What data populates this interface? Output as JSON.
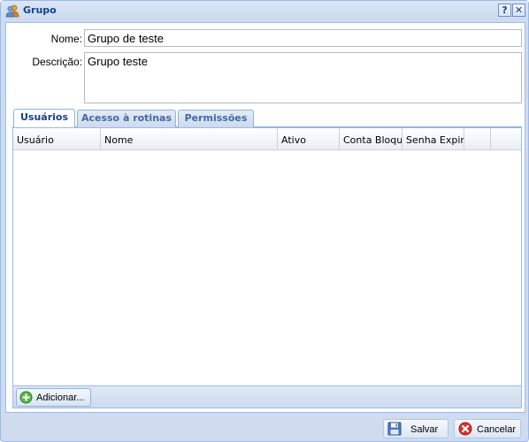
{
  "window": {
    "title": "Grupo",
    "help_label": "?",
    "close_label": "✕"
  },
  "form": {
    "nome_label": "Nome:",
    "nome_value": "Grupo de teste",
    "descricao_label": "Descrição:",
    "descricao_value": "Grupo teste"
  },
  "tabs": [
    {
      "label": "Usuários",
      "active": true
    },
    {
      "label": "Acesso à rotinas",
      "active": false
    },
    {
      "label": "Permissões",
      "active": false
    }
  ],
  "grid": {
    "columns": [
      "Usuário",
      "Nome",
      "Ativo",
      "Conta Bloque",
      "Senha Expiro",
      ""
    ],
    "rows": []
  },
  "grid_toolbar": {
    "add_label": "Adicionar..."
  },
  "footer": {
    "save_label": "Salvar",
    "cancel_label": "Cancelar"
  },
  "icons": {
    "window": "group-icon",
    "add": "add-circle-icon",
    "save": "floppy-disk-icon",
    "cancel": "cancel-icon"
  }
}
